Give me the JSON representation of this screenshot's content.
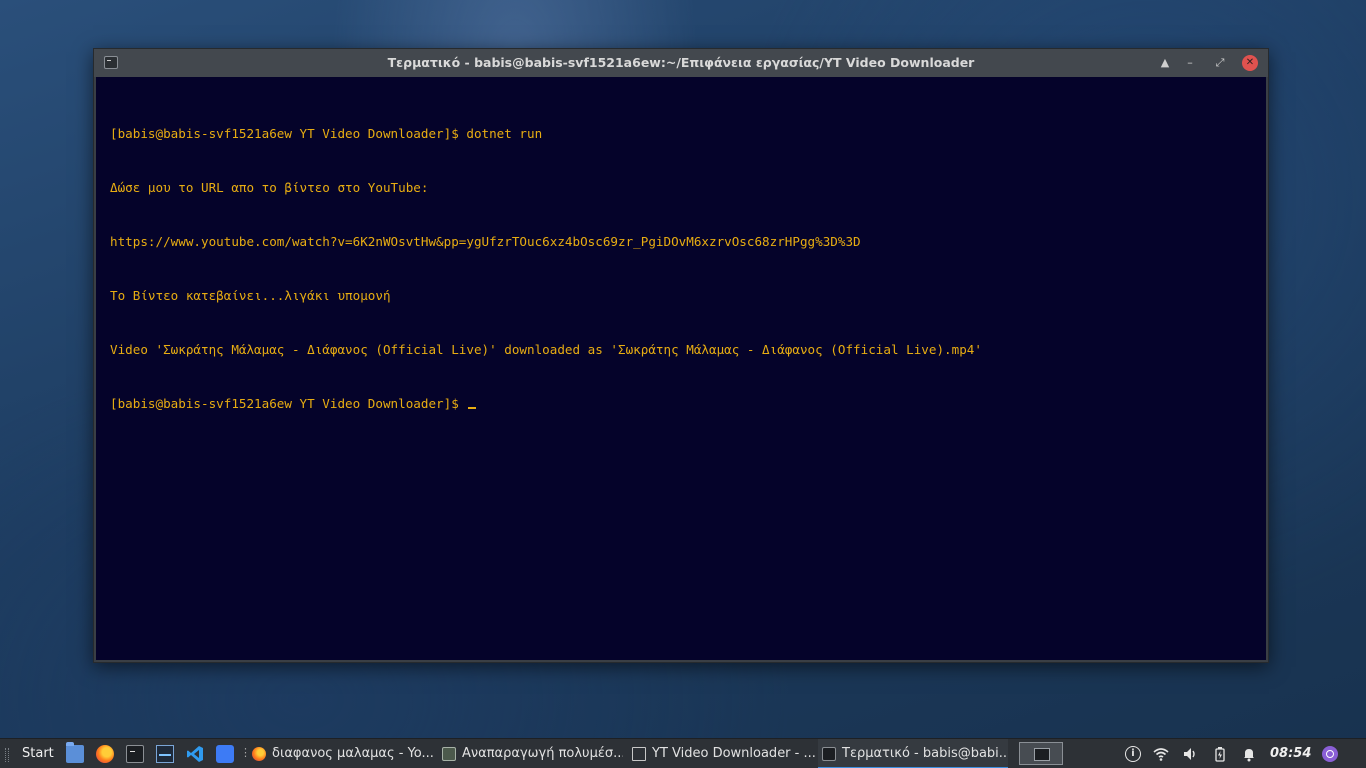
{
  "window": {
    "title": "Τερματικό - babis@babis-svf1521a6ew:~/Επιφάνεια εργασίας/YT Video Downloader",
    "controls": {
      "keep_above": "▲",
      "minimize": "–",
      "maximize": "⤢",
      "close": "✕"
    }
  },
  "terminal": {
    "lines": [
      "[babis@babis-svf1521a6ew YT Video Downloader]$ dotnet run",
      "Δώσε μου το URL απο το βίντεο στο YouTube:",
      "https://www.youtube.com/watch?v=6K2nWOsvtHw&pp=ygUfzrTOuc6xz4bOsc69zr_PgiDOvM6xzrvOsc68zrHPgg%3D%3D",
      "Το Βίντεο κατεβαίνει...λιγάκι υπομονή",
      "Video 'Σωκράτης Μάλαμας - Διάφανος (Official Live)' downloaded as 'Σωκράτης Μάλαμας - Διάφανος (Official Live).mp4'"
    ],
    "prompt": "[babis@babis-svf1521a6ew YT Video Downloader]$ ",
    "text_color": "#e8ad12",
    "background": "#05032a"
  },
  "taskbar": {
    "start_label": "Start",
    "launchers": [
      "files-icon",
      "firefox-icon",
      "terminal-icon",
      "system-monitor-icon",
      "vscode-icon",
      "software-store-icon"
    ],
    "tasks": [
      {
        "label": "διαφανος μαλαμας - Yo...",
        "icon": "firefox-icon"
      },
      {
        "label": "Αναπαραγωγή πολυμέσ...",
        "icon": "media-player-icon"
      },
      {
        "label": "YT Video Downloader - ...",
        "icon": "folder-icon"
      },
      {
        "label": "Τερματικό - babis@babi...",
        "icon": "terminal-icon",
        "active": true
      }
    ],
    "clock": "08:54",
    "accent": "#3d8fe0"
  }
}
